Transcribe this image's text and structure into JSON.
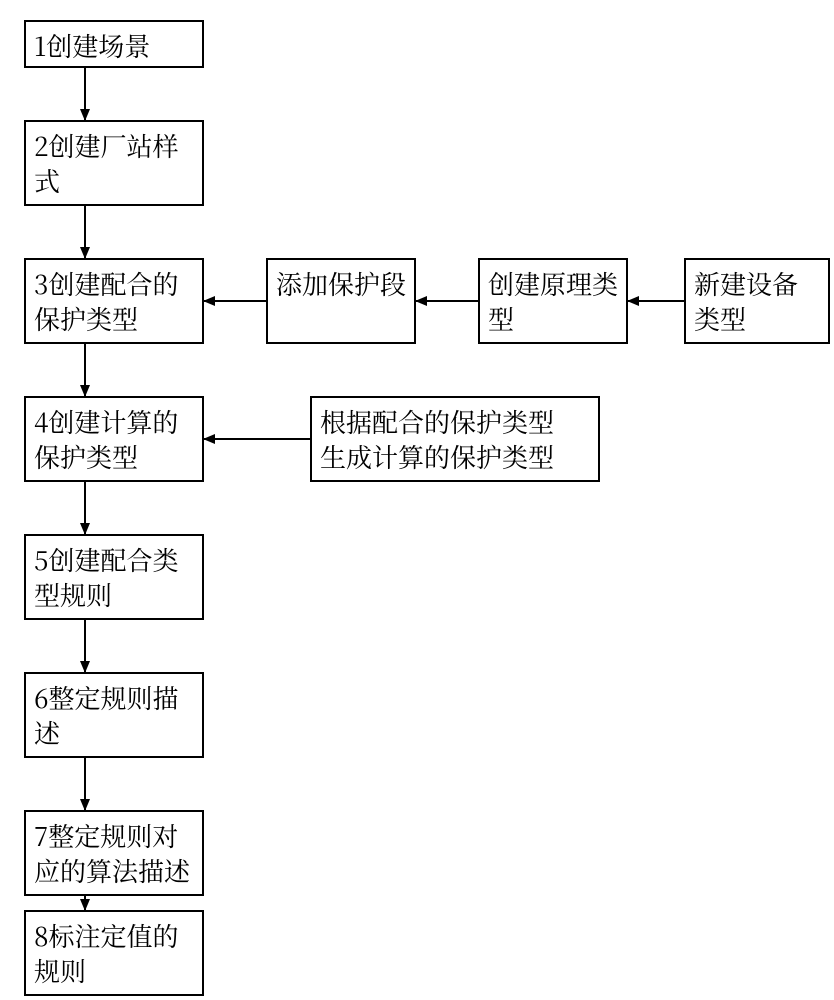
{
  "chart_data": {
    "type": "flowchart",
    "nodes": [
      {
        "id": "n1",
        "text": "1创建场景"
      },
      {
        "id": "n2",
        "text": "2创建厂站样式"
      },
      {
        "id": "n3",
        "text": "3创建配合的保护类型"
      },
      {
        "id": "n4",
        "text": "4创建计算的保护类型"
      },
      {
        "id": "n5",
        "text": "5创建配合类型规则"
      },
      {
        "id": "n6",
        "text": "6整定规则描述"
      },
      {
        "id": "n7",
        "text": "7整定规则对应的算法描述"
      },
      {
        "id": "n8",
        "text": "8标注定值的规则"
      },
      {
        "id": "s1",
        "text": "添加保护段"
      },
      {
        "id": "s2",
        "text": "创建原理类型"
      },
      {
        "id": "s3",
        "text": "新建设备类型"
      },
      {
        "id": "s4",
        "text": "根据配合的保护类型生成计算的保护类型"
      }
    ],
    "edges": [
      {
        "from": "n1",
        "to": "n2"
      },
      {
        "from": "n2",
        "to": "n3"
      },
      {
        "from": "n3",
        "to": "n4"
      },
      {
        "from": "n4",
        "to": "n5"
      },
      {
        "from": "n5",
        "to": "n6"
      },
      {
        "from": "n6",
        "to": "n7"
      },
      {
        "from": "n7",
        "to": "n8"
      },
      {
        "from": "s1",
        "to": "n3"
      },
      {
        "from": "s2",
        "to": "s1"
      },
      {
        "from": "s3",
        "to": "s2"
      },
      {
        "from": "s4",
        "to": "n4"
      }
    ]
  },
  "boxes": {
    "n1": "1创建场景",
    "n2": "2创建厂站样式",
    "n3": "3创建配合的保护类型",
    "n4": "4创建计算的保护类型",
    "n5": "5创建配合类型规则",
    "n6": "6整定规则描述",
    "n7": "7整定规则对应的算法描述",
    "n8": "8标注定值的规则",
    "s1": "添加保护段",
    "s2": "创建原理类型",
    "s3": "新建设备类型",
    "s4a": "根据配合的保护类型",
    "s4b": "生成计算的保护类型"
  }
}
